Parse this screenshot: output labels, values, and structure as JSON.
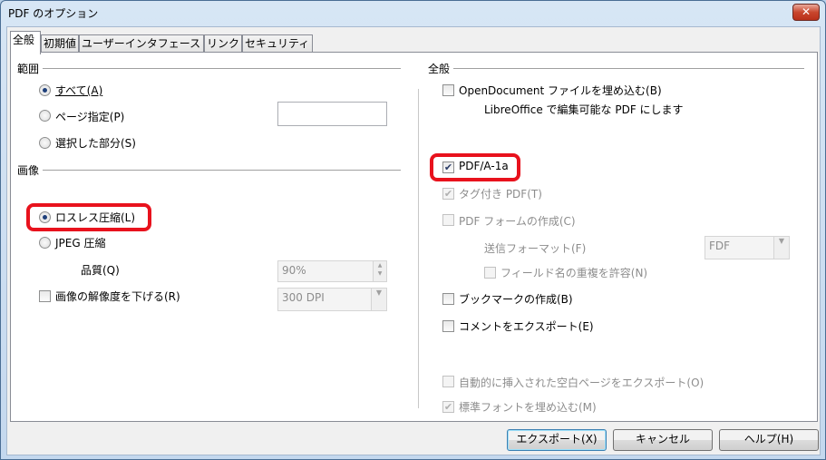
{
  "window": {
    "title": "PDF のオプション",
    "close_label": "✕"
  },
  "tabs": [
    "全般",
    "初期値",
    "ユーザーインタフェース",
    "リンク",
    "セキュリティ"
  ],
  "left": {
    "range": {
      "heading": "範囲",
      "options": [
        "すべて(A)",
        "ページ指定(P)",
        "選択した部分(S)"
      ],
      "page_input_value": ""
    },
    "image": {
      "heading": "画像",
      "lossless_label": "ロスレス圧縮(L)",
      "jpeg_label": "JPEG 圧縮",
      "quality_label": "品質(Q)",
      "quality_value": "90%",
      "reduce_label": "画像の解像度を下げる(R)",
      "resolution_value": "300 DPI"
    }
  },
  "right": {
    "heading": "全般",
    "opendocument_label": "OpenDocument ファイルを埋め込む(B)",
    "opendocument_note": "LibreOffice で編集可能な PDF にします",
    "pdfa_label": "PDF/A-1a",
    "tagged_label": "タグ付き PDF(T)",
    "form_label": "PDF フォームの作成(C)",
    "submit_format_label": "送信フォーマット(F)",
    "submit_format_value": "FDF",
    "allow_duplicate_label": "フィールド名の重複を許容(N)",
    "bookmarks_label": "ブックマークの作成(B)",
    "comments_label": "コメントをエクスポート(E)",
    "auto_blank_label": "自動的に挿入された空白ページをエクスポート(O)",
    "embed_fonts_label": "標準フォントを埋め込む(M)"
  },
  "buttons": {
    "export": "エクスポート(X)",
    "cancel": "キャンセル",
    "help": "ヘルプ(H)"
  },
  "colors": {
    "highlight": "#e8121d",
    "window_frame": "#4a6e94"
  }
}
